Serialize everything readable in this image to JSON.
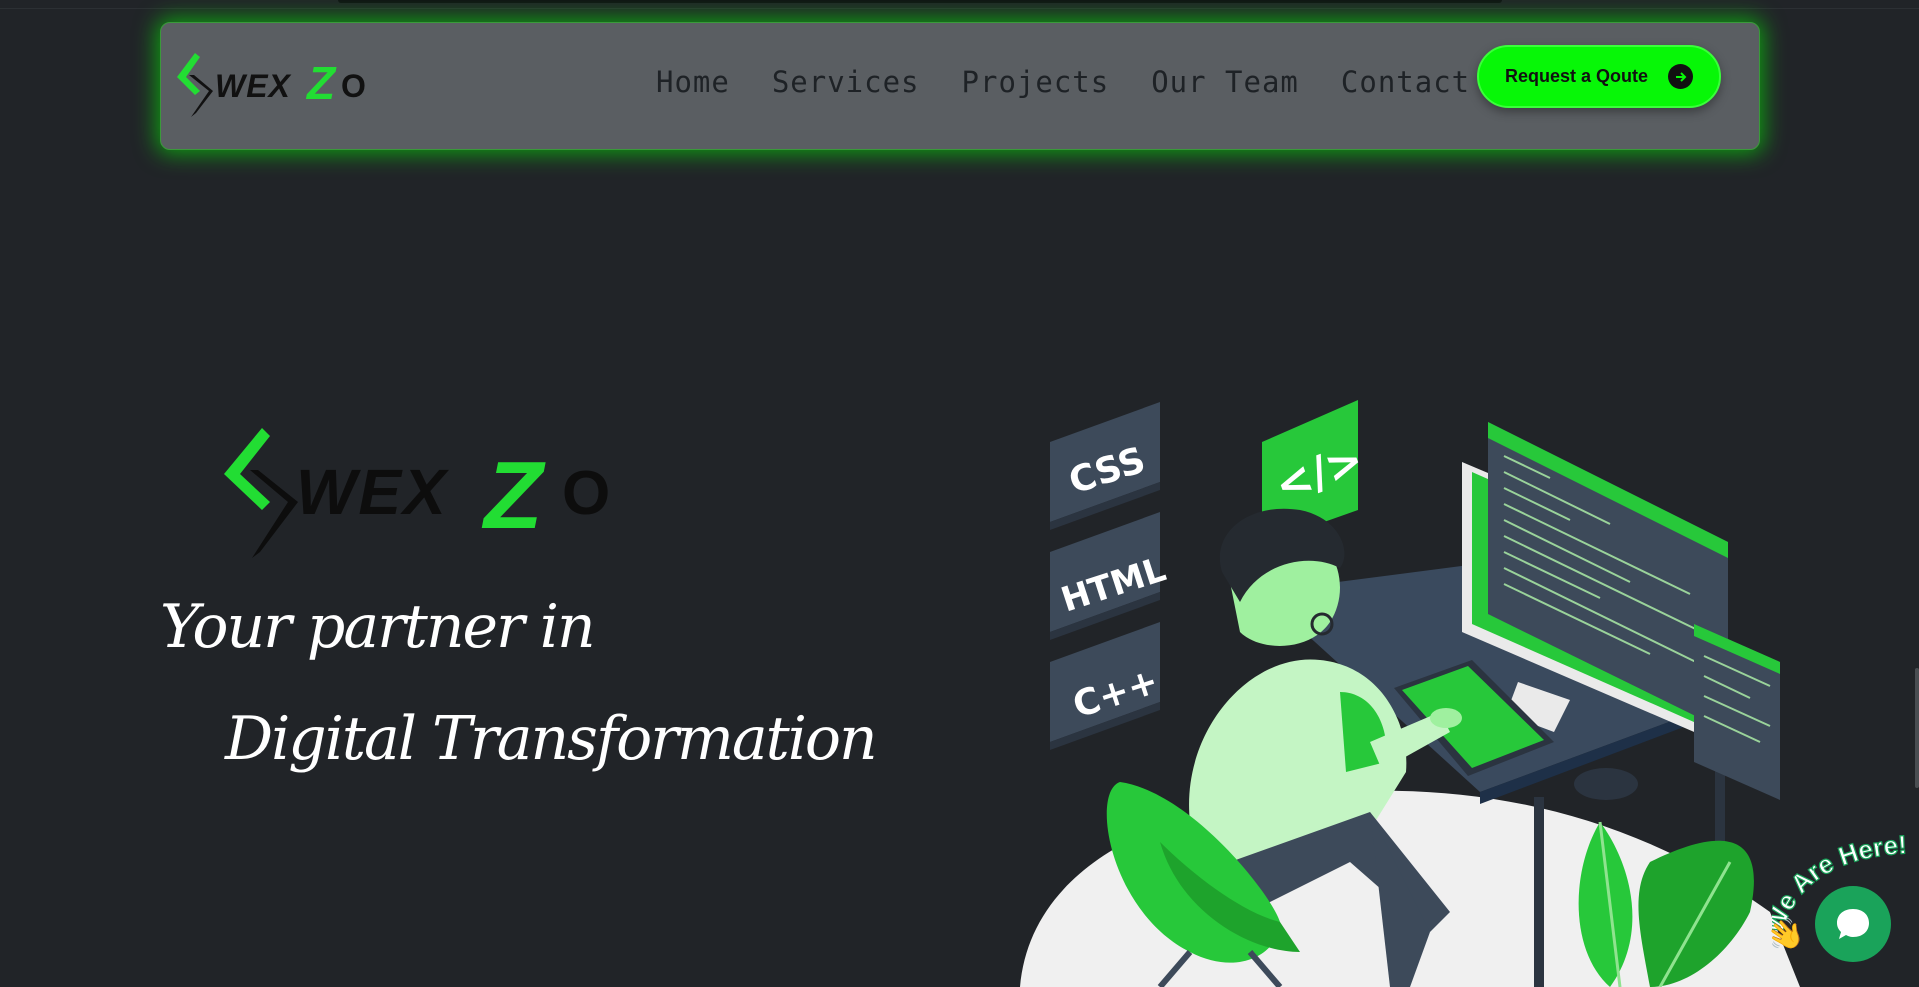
{
  "brand": {
    "name": "WEXZO",
    "accent": "#07f707",
    "background": "#212428",
    "navbar_bg": "#5a5e62"
  },
  "nav": {
    "links": [
      "Home",
      "Services",
      "Projects",
      "Our Team",
      "Contact us"
    ],
    "cta_label": "Request a Qoute",
    "cta_icon": "arrow-right-circle-icon"
  },
  "hero": {
    "tagline_line1": "Your partner in",
    "tagline_line2": "Digital Transformation"
  },
  "illustration": {
    "tags": [
      "CSS",
      "HTML",
      "C++"
    ],
    "code_bubble": "</>"
  },
  "chat": {
    "label": "We Are Here!",
    "icon": "chat-bubble-icon",
    "wave_icon": "waving-hand-icon"
  }
}
